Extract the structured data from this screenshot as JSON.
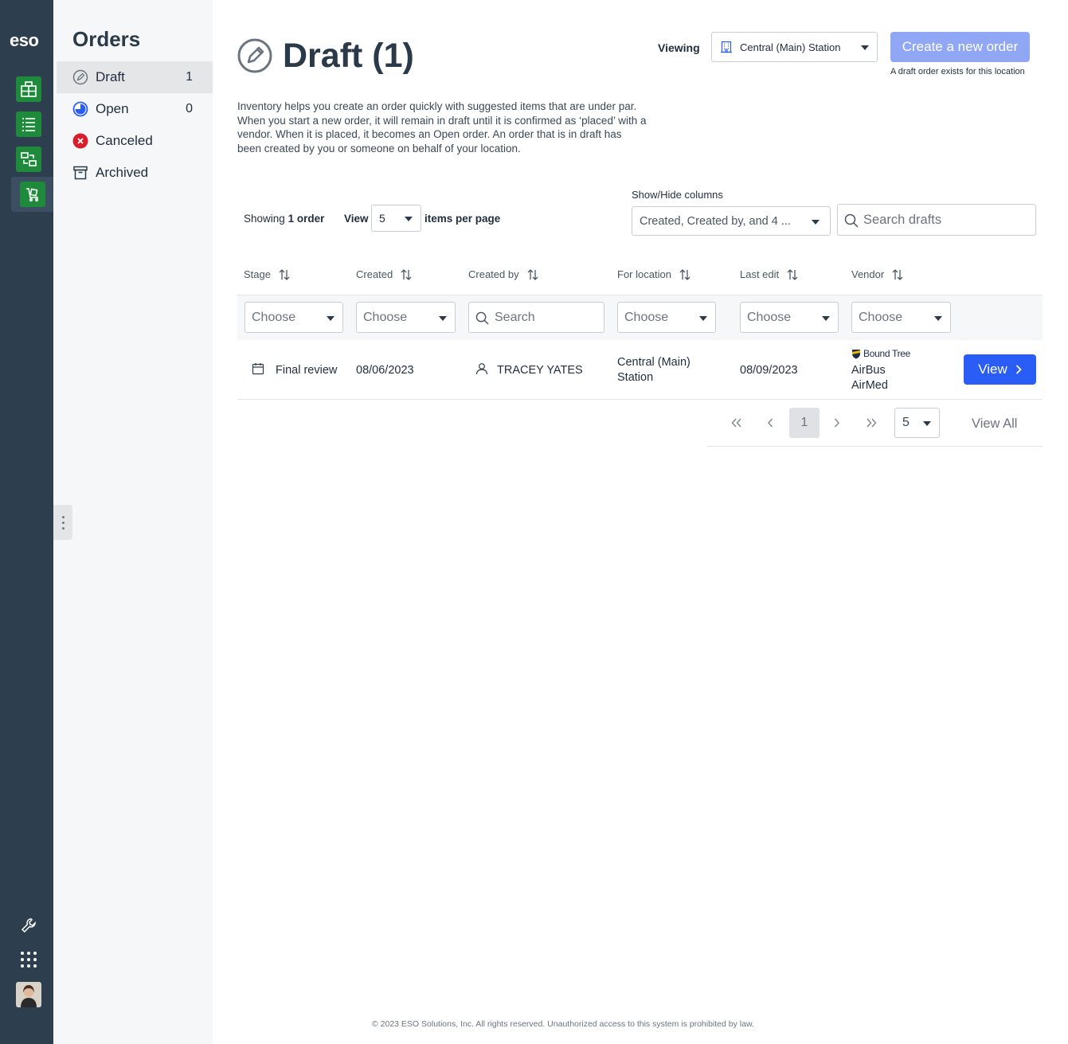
{
  "app": {
    "logo": "eso"
  },
  "sidebar": {
    "title": "Orders",
    "items": [
      {
        "label": "Draft",
        "count": "1",
        "icon": "pencil-circle-icon"
      },
      {
        "label": "Open",
        "count": "0",
        "icon": "progress-circle-icon"
      },
      {
        "label": "Canceled",
        "count": "",
        "icon": "x-circle-icon"
      },
      {
        "label": "Archived",
        "count": "",
        "icon": "archive-box-icon"
      }
    ]
  },
  "header": {
    "title": "Draft (1)",
    "viewing_label": "Viewing",
    "location": "Central (Main) Station",
    "create_button": "Create a new order",
    "draft_note": "A draft order exists for this location"
  },
  "intro": "Inventory helps you create an order quickly with suggested items that are under par. When you start a new order, it will remain in draft until it is confirmed as ‘placed’ with a vendor. When it is placed, it becomes an Open order. An order that is in draft has been created by you or someone on behalf of your location.",
  "toolbar": {
    "showing_prefix": "Showing",
    "showing_count": "1 order",
    "view_label": "View",
    "per_page_value": "5",
    "per_page_label": "items per page",
    "showhide_label": "Show/Hide columns",
    "showhide_value": "Created, Created by, and 4 ...",
    "search_placeholder": "Search drafts"
  },
  "table": {
    "columns": [
      "Stage",
      "Created",
      "Created by",
      "For location",
      "Last edit",
      "Vendor"
    ],
    "filters": {
      "choose": "Choose",
      "search": "Search"
    },
    "rows": [
      {
        "stage": "Final review",
        "created": "08/06/2023",
        "created_by": "TRACEY YATES",
        "location_line1": "Central (Main)",
        "location_line2": "Station",
        "last_edit": "08/09/2023",
        "vendor_logo": "Bound Tree",
        "vendor_line1": "AirBus",
        "vendor_line2": "AirMed",
        "action": "View"
      }
    ]
  },
  "pager": {
    "current_page": "1",
    "page_size": "5",
    "view_all": "View All"
  },
  "footer": "© 2023 ESO Solutions, Inc. All rights reserved. Unauthorized access to this system is prohibited by law.",
  "colors": {
    "rail": "#2d3e4e",
    "brand_green": "#1f8a3c",
    "primary_blue": "#2a5df5",
    "disabled_blue": "#8fa7f5"
  }
}
